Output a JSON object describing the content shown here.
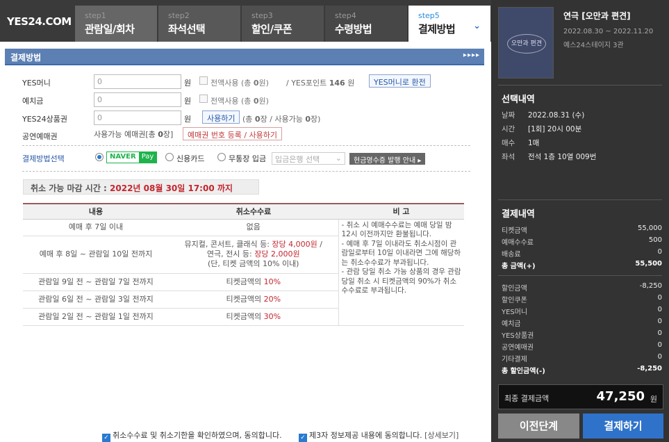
{
  "header": {
    "logo": "YES24.COM",
    "steps": [
      {
        "num": "step1",
        "label": "관람일/회차"
      },
      {
        "num": "step2",
        "label": "좌석선택"
      },
      {
        "num": "step3",
        "label": "할인/쿠폰"
      },
      {
        "num": "step4",
        "label": "수령방법"
      },
      {
        "num": "step5",
        "label": "결제방법"
      }
    ]
  },
  "section": {
    "title": "결제방법",
    "arrows": "▸▸▸▸"
  },
  "form": {
    "yes_money": {
      "label": "YES머니",
      "value": "0",
      "unit": "원",
      "use_all": "전액사용 (총 ",
      "amount": "0",
      "suffix": "원)",
      "points_label": "/ YES포인트",
      "points": "146",
      "points_unit": "원",
      "convert_btn": "YES머니로 환전"
    },
    "deposit": {
      "label": "예치금",
      "value": "0",
      "unit": "원",
      "use_all": "전액사용 (총 ",
      "amount": "0",
      "suffix": "원)"
    },
    "gift": {
      "label": "YES24상품권",
      "value": "0",
      "unit": "원",
      "use_btn": "사용하기",
      "info1": "(총 ",
      "count": "0",
      "info2": "장 / 사용가능 ",
      "avail": "0",
      "info3": "장)"
    },
    "voucher": {
      "label": "공연예매권",
      "info": "사용가능 예매권[총 ",
      "count": "0",
      "suffix": "장]",
      "btn": "예매권 번호 등록 / 사용하기"
    },
    "method": {
      "label": "결제방법선택",
      "naver": "NAVER",
      "pay": "Pay",
      "credit": "신용카드",
      "bank": "무통장 입금",
      "bank_select": "입금은행 선택",
      "receipt_btn": "현금영수증 발행 안내 ▸"
    }
  },
  "deadline": {
    "label": "취소 가능 마감 시간 :",
    "value": "2022년 08월 30일 17:00 까지"
  },
  "cancel_table": {
    "headers": [
      "내용",
      "취소수수료",
      "비 고"
    ],
    "rows": [
      {
        "period": "예매 후 7일 이내",
        "fee": "없음"
      },
      {
        "period": "예매 후 8일 ~ 관람일 10일 전까지",
        "fee_l1a": "뮤지컬, 콘서트, 클래식 등: ",
        "fee_l1b": "장당 4,000원",
        "fee_l1c": " /",
        "fee_l2a": "연극, 전시 등: ",
        "fee_l2b": "장당 2,000원",
        "fee_l3": "(단, 티켓 금액의 10% 이내)"
      },
      {
        "period": "관람일 9일 전 ~ 관람일 7일 전까지",
        "fee_a": "티켓금액의 ",
        "fee_b": "10%"
      },
      {
        "period": "관람일 6일 전 ~ 관람일 3일 전까지",
        "fee_a": "티켓금액의 ",
        "fee_b": "20%"
      },
      {
        "period": "관람일 2일 전 ~ 관람일 1일 전까지",
        "fee_a": "티켓금액의 ",
        "fee_b": "30%"
      }
    ],
    "note": "- 취소 시 예매수수료는 예매 당일 밤 12시 이전까지만 환불됩니다.\n- 예매 후 7일 이내라도 취소시점이 관람일로부터 10일 이내라면 그에 해당하는 취소수수료가 부과됩니다.\n- 관람 당일 취소 가능 상품의 경우 관람 당일 취소 시 티켓금액의 90%가 취소수수료로 부과됩니다."
  },
  "agree": {
    "a1": "취소수수료 및 취소기한을 확인하였으며, 동의합니다.",
    "a2": "제3자 정보제공 내용에 동의합니다.",
    "detail": "[상세보기]"
  },
  "sidebar": {
    "poster_text": "오만과 편견",
    "title": "연극 [오만과 편견]",
    "dates": "2022.08.30 ~ 2022.11.20",
    "venue": "예스24스테이지 3관",
    "selection_head": "선택내역",
    "selection": [
      {
        "k": "날짜",
        "v": "2022.08.31 (수)"
      },
      {
        "k": "시간",
        "v": "[1회] 20시 00분"
      },
      {
        "k": "매수",
        "v": "1매"
      },
      {
        "k": "좌석",
        "v": "전석 1층 10열 009번"
      }
    ],
    "pay_head": "결제내역",
    "pay1": [
      {
        "k": "티켓금액",
        "v": "55,000"
      },
      {
        "k": "예매수수료",
        "v": "500"
      },
      {
        "k": "배송료",
        "v": "0"
      },
      {
        "k": "총 금액(+)",
        "v": "55,500"
      }
    ],
    "pay2": [
      {
        "k": "할인금액",
        "v": "-8,250"
      },
      {
        "k": "할인쿠폰",
        "v": "0"
      },
      {
        "k": "YES머니",
        "v": "0"
      },
      {
        "k": "예치금",
        "v": "0"
      },
      {
        "k": "YES상품권",
        "v": "0"
      },
      {
        "k": "공연예매권",
        "v": "0"
      },
      {
        "k": "기타결제",
        "v": "0"
      },
      {
        "k": "총 할인금액(-)",
        "v": "-8,250"
      }
    ],
    "final_label": "최종 결제금액",
    "final_value": "47,250",
    "final_unit": "원",
    "prev_btn": "이전단계",
    "pay_btn": "결제하기"
  }
}
